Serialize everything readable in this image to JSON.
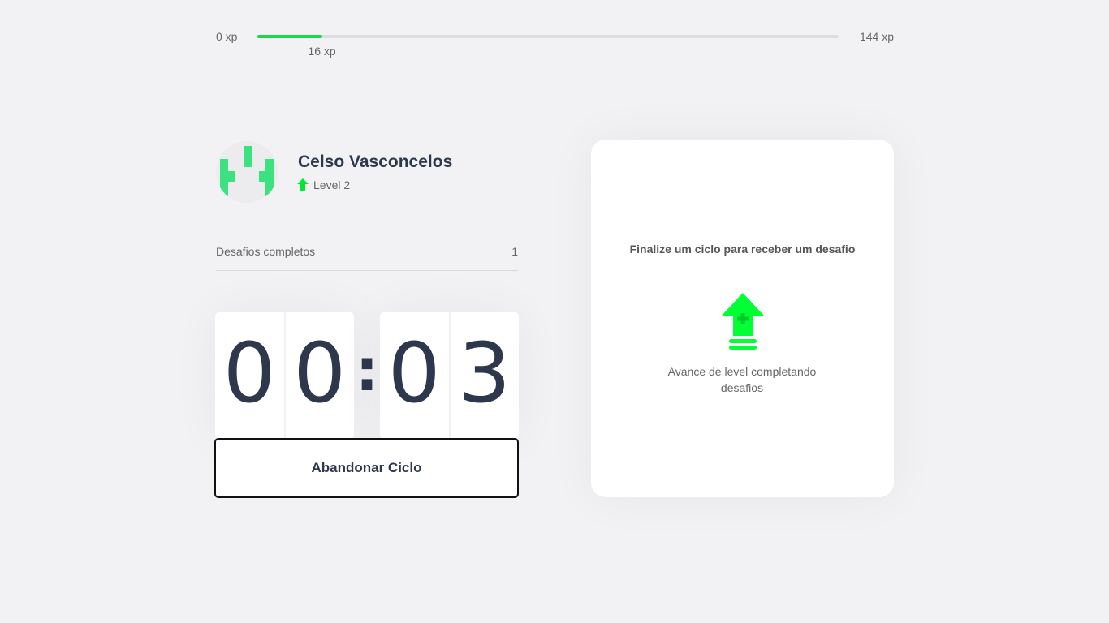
{
  "xp_bar": {
    "min_label": "0 xp",
    "max_label": "144 xp",
    "current_label": "16 xp",
    "current_xp": 16,
    "max_xp": 144,
    "fill_color": "#1ed84b"
  },
  "profile": {
    "name": "Celso Vasconcelos",
    "level_label": "Level 2",
    "avatar_icon": "green-logo-avatar",
    "level_icon": "green-up-arrow-icon"
  },
  "completed_challenges": {
    "label": "Desafios completos",
    "count": "1"
  },
  "countdown": {
    "minutes": [
      "0",
      "0"
    ],
    "separator": ":",
    "seconds": [
      "0",
      "3"
    ]
  },
  "abandon_button": {
    "label": "Abandonar Ciclo"
  },
  "challenge_box": {
    "title": "Finalize um ciclo para receber um desafio",
    "subtitle": "Avance de level completando desafios",
    "icon": "level-up-arrow-icon",
    "accent_color": "#00ff33"
  },
  "colors": {
    "background": "#f2f2f4",
    "title_text": "#2e384d",
    "body_text": "#666666",
    "green": "#1ed84b"
  }
}
